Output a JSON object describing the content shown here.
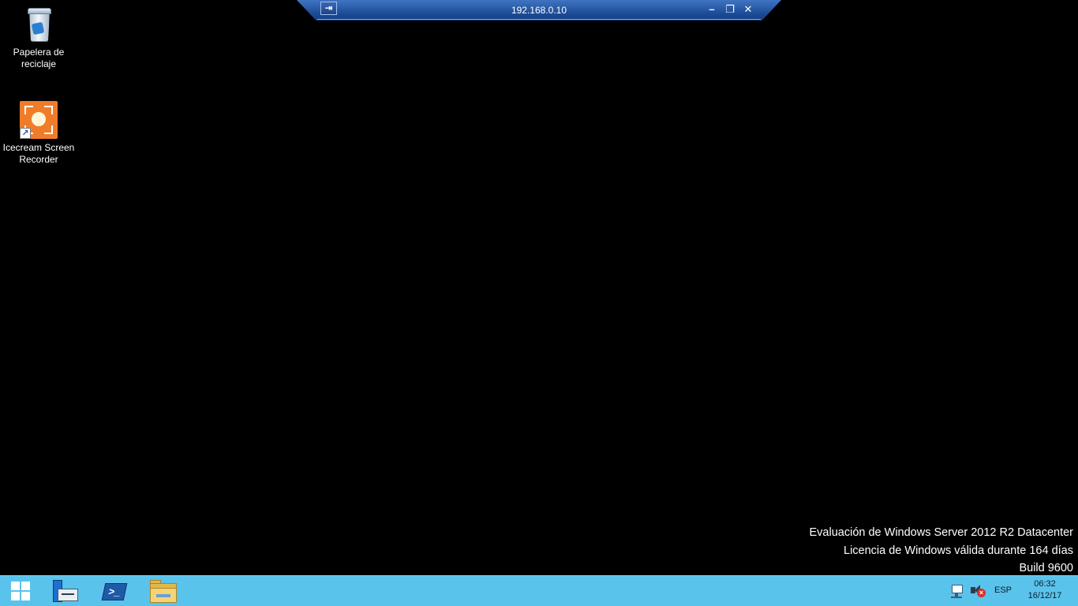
{
  "desktop": {
    "icons": [
      {
        "label": "Papelera de reciclaje",
        "icon": "recycle-bin-icon"
      },
      {
        "label": "Icecream Screen Recorder",
        "icon": "icecream-screen-recorder-icon"
      }
    ]
  },
  "rdp_bar": {
    "title": "192.168.0.10",
    "pin_icon": "pin-icon",
    "minimize_icon": "minimize-icon",
    "restore_icon": "restore-icon",
    "close_icon": "close-icon"
  },
  "watermark": {
    "line1": "Evaluación de Windows Server 2012 R2 Datacenter",
    "line2": "Licencia de Windows válida durante 164 días",
    "line3": "Build 9600"
  },
  "taskbar": {
    "pinned": [
      {
        "icon": "windows-start-icon"
      },
      {
        "icon": "server-manager-icon"
      },
      {
        "icon": "powershell-icon"
      },
      {
        "icon": "file-explorer-icon"
      }
    ],
    "tray": {
      "network_icon": "network-icon",
      "volume_icon": "volume-muted-icon",
      "language": "ESP",
      "time": "06:32",
      "date": "16/12/17"
    },
    "background_color": "#5ac3ec"
  }
}
